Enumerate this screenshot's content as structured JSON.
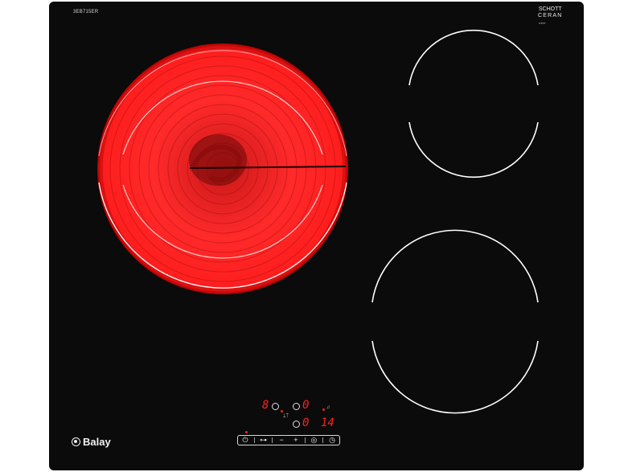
{
  "model_code": "3EB715ER",
  "glass_brand": {
    "line1": "SCHOTT",
    "line2": "CERAN"
  },
  "brand_name": "Balay",
  "display": {
    "left_digit": "8",
    "mid_top": "0",
    "mid_bottom": "0",
    "timer": "14"
  },
  "controls": [
    "⏻",
    "⊶",
    "−",
    "+",
    "◎",
    "◷"
  ],
  "colors": {
    "glass": "#0b0b0b",
    "heat": "#ff2222",
    "indicator": "#ff2020",
    "lines": "#ffffff"
  }
}
